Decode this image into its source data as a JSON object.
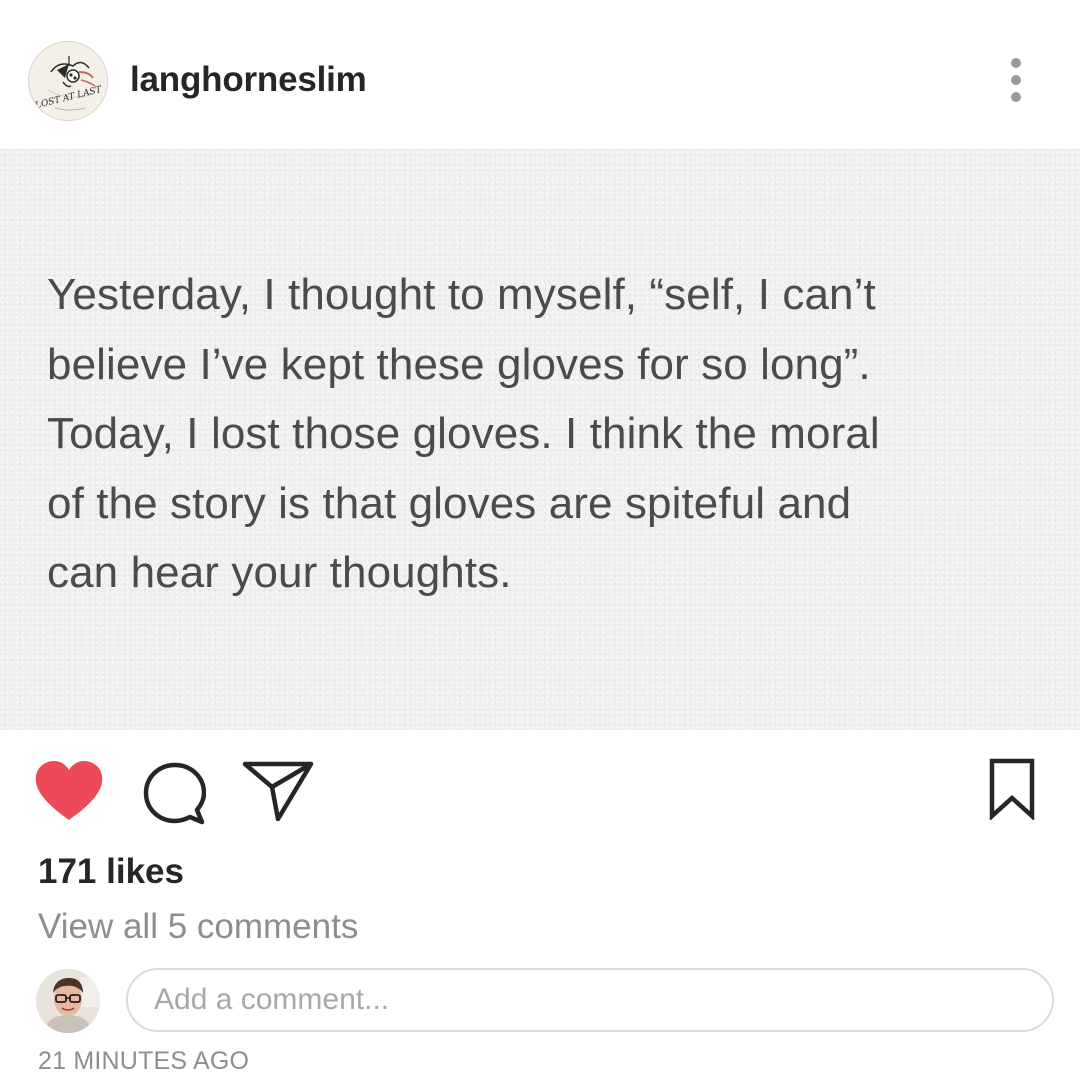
{
  "header": {
    "username": "langhorneslim",
    "avatar_icon": "lost-at-last-album-logo",
    "avatar_text": "LOST AT LAST",
    "more_icon": "vertical-ellipsis-icon"
  },
  "post": {
    "text": "Yesterday,  I thought to myself, “self, I can’t\nbelieve I’ve kept these gloves for so long”.\nToday, I lost those gloves. I think the moral\nof the story is that gloves are spiteful and\ncan hear your thoughts."
  },
  "actions": {
    "like_icon": "heart-filled-icon",
    "like_color": "#ed4956",
    "comment_icon": "comment-bubble-icon",
    "share_icon": "paper-plane-icon",
    "save_icon": "bookmark-icon"
  },
  "likes": "171 likes",
  "view_comments": "View all 5 comments",
  "comment_input": {
    "placeholder": "Add a comment..."
  },
  "timestamp": "21 MINUTES AGO"
}
